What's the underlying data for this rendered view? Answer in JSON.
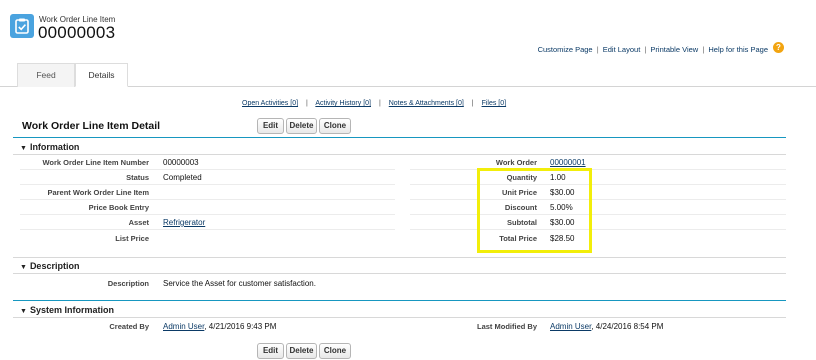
{
  "header": {
    "object_label": "Work Order Line Item",
    "record_name": "00000003"
  },
  "top_links": {
    "customize": "Customize Page",
    "edit_layout": "Edit Layout",
    "printable": "Printable View",
    "help": "Help for this Page",
    "separator": "|",
    "help_icon": "?"
  },
  "tabs": {
    "feed": "Feed",
    "details": "Details"
  },
  "related": {
    "open_activities": "Open Activities [0]",
    "activity_history": "Activity History [0]",
    "notes": "Notes & Attachments [0]",
    "files": "Files [0]",
    "separator": "|"
  },
  "detail": {
    "title": "Work Order Line Item Detail",
    "edit": "Edit",
    "delete": "Delete",
    "clone": "Clone"
  },
  "information": {
    "heading": "Information",
    "left": [
      {
        "label": "Work Order Line Item Number",
        "value": "00000003"
      },
      {
        "label": "Status",
        "value": "Completed"
      },
      {
        "label": "Parent Work Order Line Item",
        "value": ""
      },
      {
        "label": "Price Book Entry",
        "value": ""
      },
      {
        "label": "Asset",
        "value": "Refrigerator"
      },
      {
        "label": "List Price",
        "value": ""
      }
    ],
    "right": [
      {
        "label": "Work Order",
        "value": "00000001"
      },
      {
        "label": "Quantity",
        "value": "1.00"
      },
      {
        "label": "Unit Price",
        "value": "$30.00"
      },
      {
        "label": "Discount",
        "value": "5.00%"
      },
      {
        "label": "Subtotal",
        "value": "$30.00"
      },
      {
        "label": "Total Price",
        "value": "$28.50"
      }
    ]
  },
  "description": {
    "heading": "Description",
    "label": "Description",
    "value": "Service the Asset for customer satisfaction."
  },
  "system": {
    "heading": "System Information",
    "created_label": "Created By",
    "created_user": "Admin User",
    "created_date": ", 4/21/2016 9:43 PM",
    "modified_label": "Last Modified By",
    "modified_user": "Admin User",
    "modified_date": ", 4/24/2016 8:54 PM"
  },
  "colors": {
    "accent_blue": "#1797c0",
    "icon_blue": "#4aa3df",
    "highlight_yellow": "#f2ee0a",
    "help_orange": "#f2a410"
  }
}
